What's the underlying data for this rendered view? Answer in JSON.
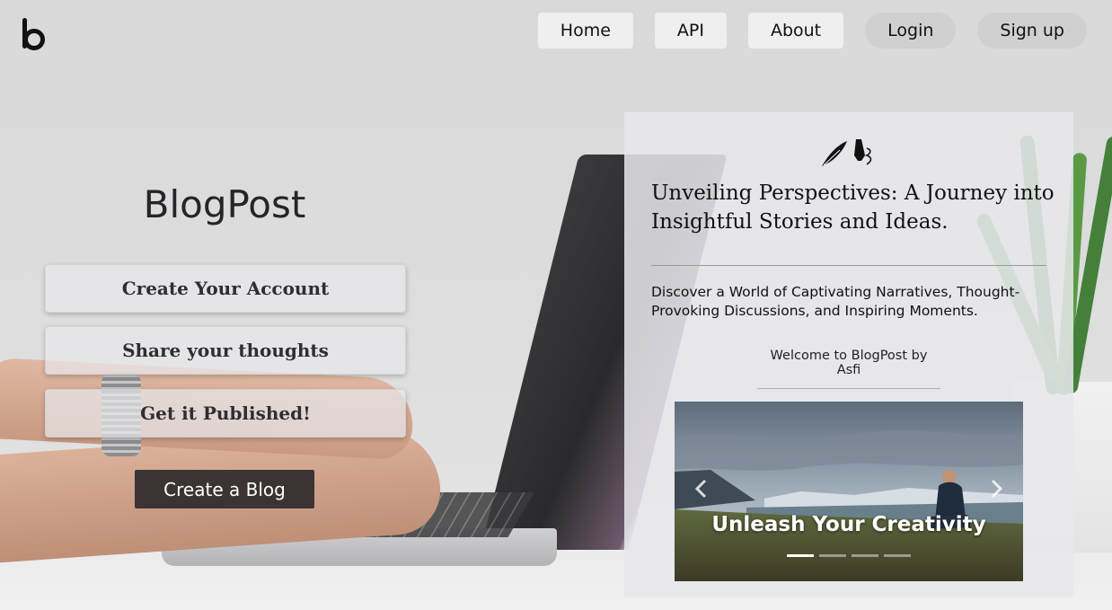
{
  "nav": {
    "items": [
      {
        "label": "Home"
      },
      {
        "label": "API"
      },
      {
        "label": "About"
      }
    ],
    "login_label": "Login",
    "signup_label": "Sign up"
  },
  "hero": {
    "brand_title": "BlogPost",
    "features": [
      {
        "label": "Create Your Account"
      },
      {
        "label": "Share your thoughts"
      },
      {
        "label": "Get it Published!"
      }
    ],
    "cta_label": "Create a Blog"
  },
  "panel": {
    "headline": "Unveiling Perspectives: A Journey into Insightful Stories and Ideas.",
    "subtext": "Discover a World of Captivating Narratives, Thought-Provoking Discussions, and Inspiring Moments.",
    "welcome": "Welcome to BlogPost by Asfi",
    "icon": "quill-and-pen-icon"
  },
  "carousel": {
    "caption": "Unleash Your Creativity",
    "active_slide": 1,
    "slide_count": 4
  },
  "colors": {
    "cta_bg": "#3b3433",
    "nav_button_bg": "#efefef",
    "auth_button_bg": "#d0d0d0"
  }
}
